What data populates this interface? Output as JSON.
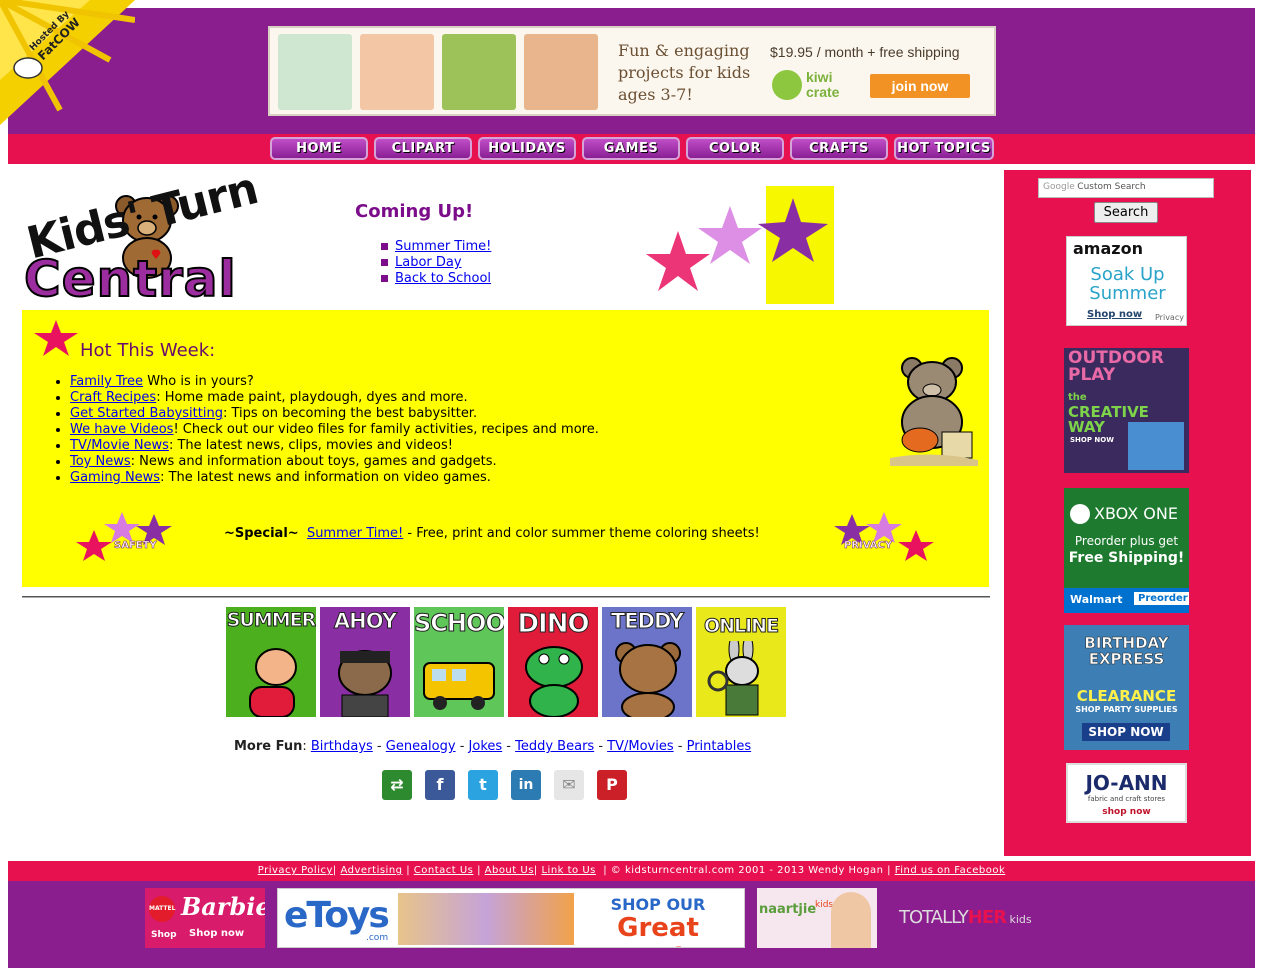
{
  "hosted_by": {
    "line1": "Hosted By",
    "line2": "FatCOW"
  },
  "banner": {
    "text": "Fun & engaging projects for kids ages 3-7!",
    "price": "$19.95 / month + free shipping",
    "brand_line1": "kiwi",
    "brand_line2": "crate",
    "cta": "join now"
  },
  "nav": [
    "HOME",
    "CLIPART",
    "HOLIDAYS",
    "GAMES",
    "COLOR",
    "CRAFTS",
    "HOT TOPICS"
  ],
  "logo": {
    "line1": "Kids' Turn",
    "line2": "Central"
  },
  "coming_up": {
    "title": "Coming Up!",
    "items": [
      "Summer Time!",
      "Labor Day",
      "Back to School"
    ]
  },
  "hot": {
    "title": "Hot This Week:",
    "items": [
      {
        "link": "Family Tree",
        "text": " Who is in yours?"
      },
      {
        "link": "Craft Recipes",
        "text": ": Home made paint, playdough, dyes and more."
      },
      {
        "link": "Get Started Babysitting",
        "text": ": Tips on becoming the best babysitter."
      },
      {
        "link": "We have Videos",
        "text": "! Check out our video files for family activities, recipes and more."
      },
      {
        "link": "TV/Movie News",
        "text": ": The latest news, clips, movies and videos!"
      },
      {
        "link": "Toy News",
        "text": ": News and information about toys, games and gadgets."
      },
      {
        "link": "Gaming News",
        "text": ": The latest news and information on video games."
      }
    ],
    "safety_label": "SAFETY",
    "privacy_label": "PRIVACY",
    "special_prefix": "~Special~",
    "special_link": "Summer Time!",
    "special_text": " - Free, print and color summer theme coloring sheets!"
  },
  "tiles": [
    {
      "label": "SUMMER",
      "bg": "#4caf1e"
    },
    {
      "label": "AHOY",
      "bg": "#8a2fa3"
    },
    {
      "label": "SCHOOL",
      "bg": "#5fc75a"
    },
    {
      "label": "DINO",
      "bg": "#e11c3a"
    },
    {
      "label": "TEDDY",
      "bg": "#6b74c9"
    },
    {
      "label": "ONLINE",
      "bg": "#e8e81a"
    }
  ],
  "more_fun": {
    "label": "More Fun",
    "links": [
      "Birthdays",
      "Genealogy",
      "Jokes",
      "Teddy Bears",
      "TV/Movies",
      "Printables"
    ],
    "separator": " - "
  },
  "search": {
    "placeholder": "Custom Search",
    "google": "Google",
    "button": "Search"
  },
  "ads": {
    "amazon": {
      "brand": "amazon",
      "line1": "Soak Up",
      "line2": "Summer",
      "cta": "Shop now",
      "privacy": "Privacy"
    },
    "crayola": {
      "line1": "OUTDOOR",
      "line2": "PLAY",
      "line3": "the",
      "line4": "CREATIVE",
      "line5": "WAY",
      "cta": "SHOP NOW"
    },
    "xbox": {
      "title": "XBOX ONE",
      "line1": "Preorder plus get",
      "line2": "Free Shipping!",
      "walmart": "Walmart",
      "cta": "Preorder"
    },
    "birthday": {
      "line1": "BIRTHDAY",
      "line2": "EXPRESS",
      "line3": "CLEARANCE",
      "line4": "SHOP PARTY SUPPLIES",
      "cta": "SHOP NOW"
    },
    "joann": {
      "brand": "JO-ANN",
      "sub": "fabric and craft stores",
      "cta": "shop now"
    }
  },
  "footer": {
    "links": [
      "Privacy Policy",
      "Advertising",
      "Contact Us",
      "About Us",
      "Link to Us",
      "Find us on Facebook"
    ],
    "copyright": "© kidsturncentral.com 2001 - 2013 Wendy Hogan"
  },
  "bottom_ads": {
    "barbie": {
      "brand": "MATTEL",
      "title": "Barbie",
      "shop": "Shop",
      "cta": "Shop now"
    },
    "etoys": {
      "brand": "eToys",
      "sub": ".com",
      "line1": "SHOP OUR",
      "line2": "Great Deals"
    },
    "naartjie": {
      "brand": "naartjie",
      "sub": "kids"
    },
    "totally": {
      "part1": "TOTALLY",
      "part2": "HER",
      "part3": "kids"
    }
  }
}
